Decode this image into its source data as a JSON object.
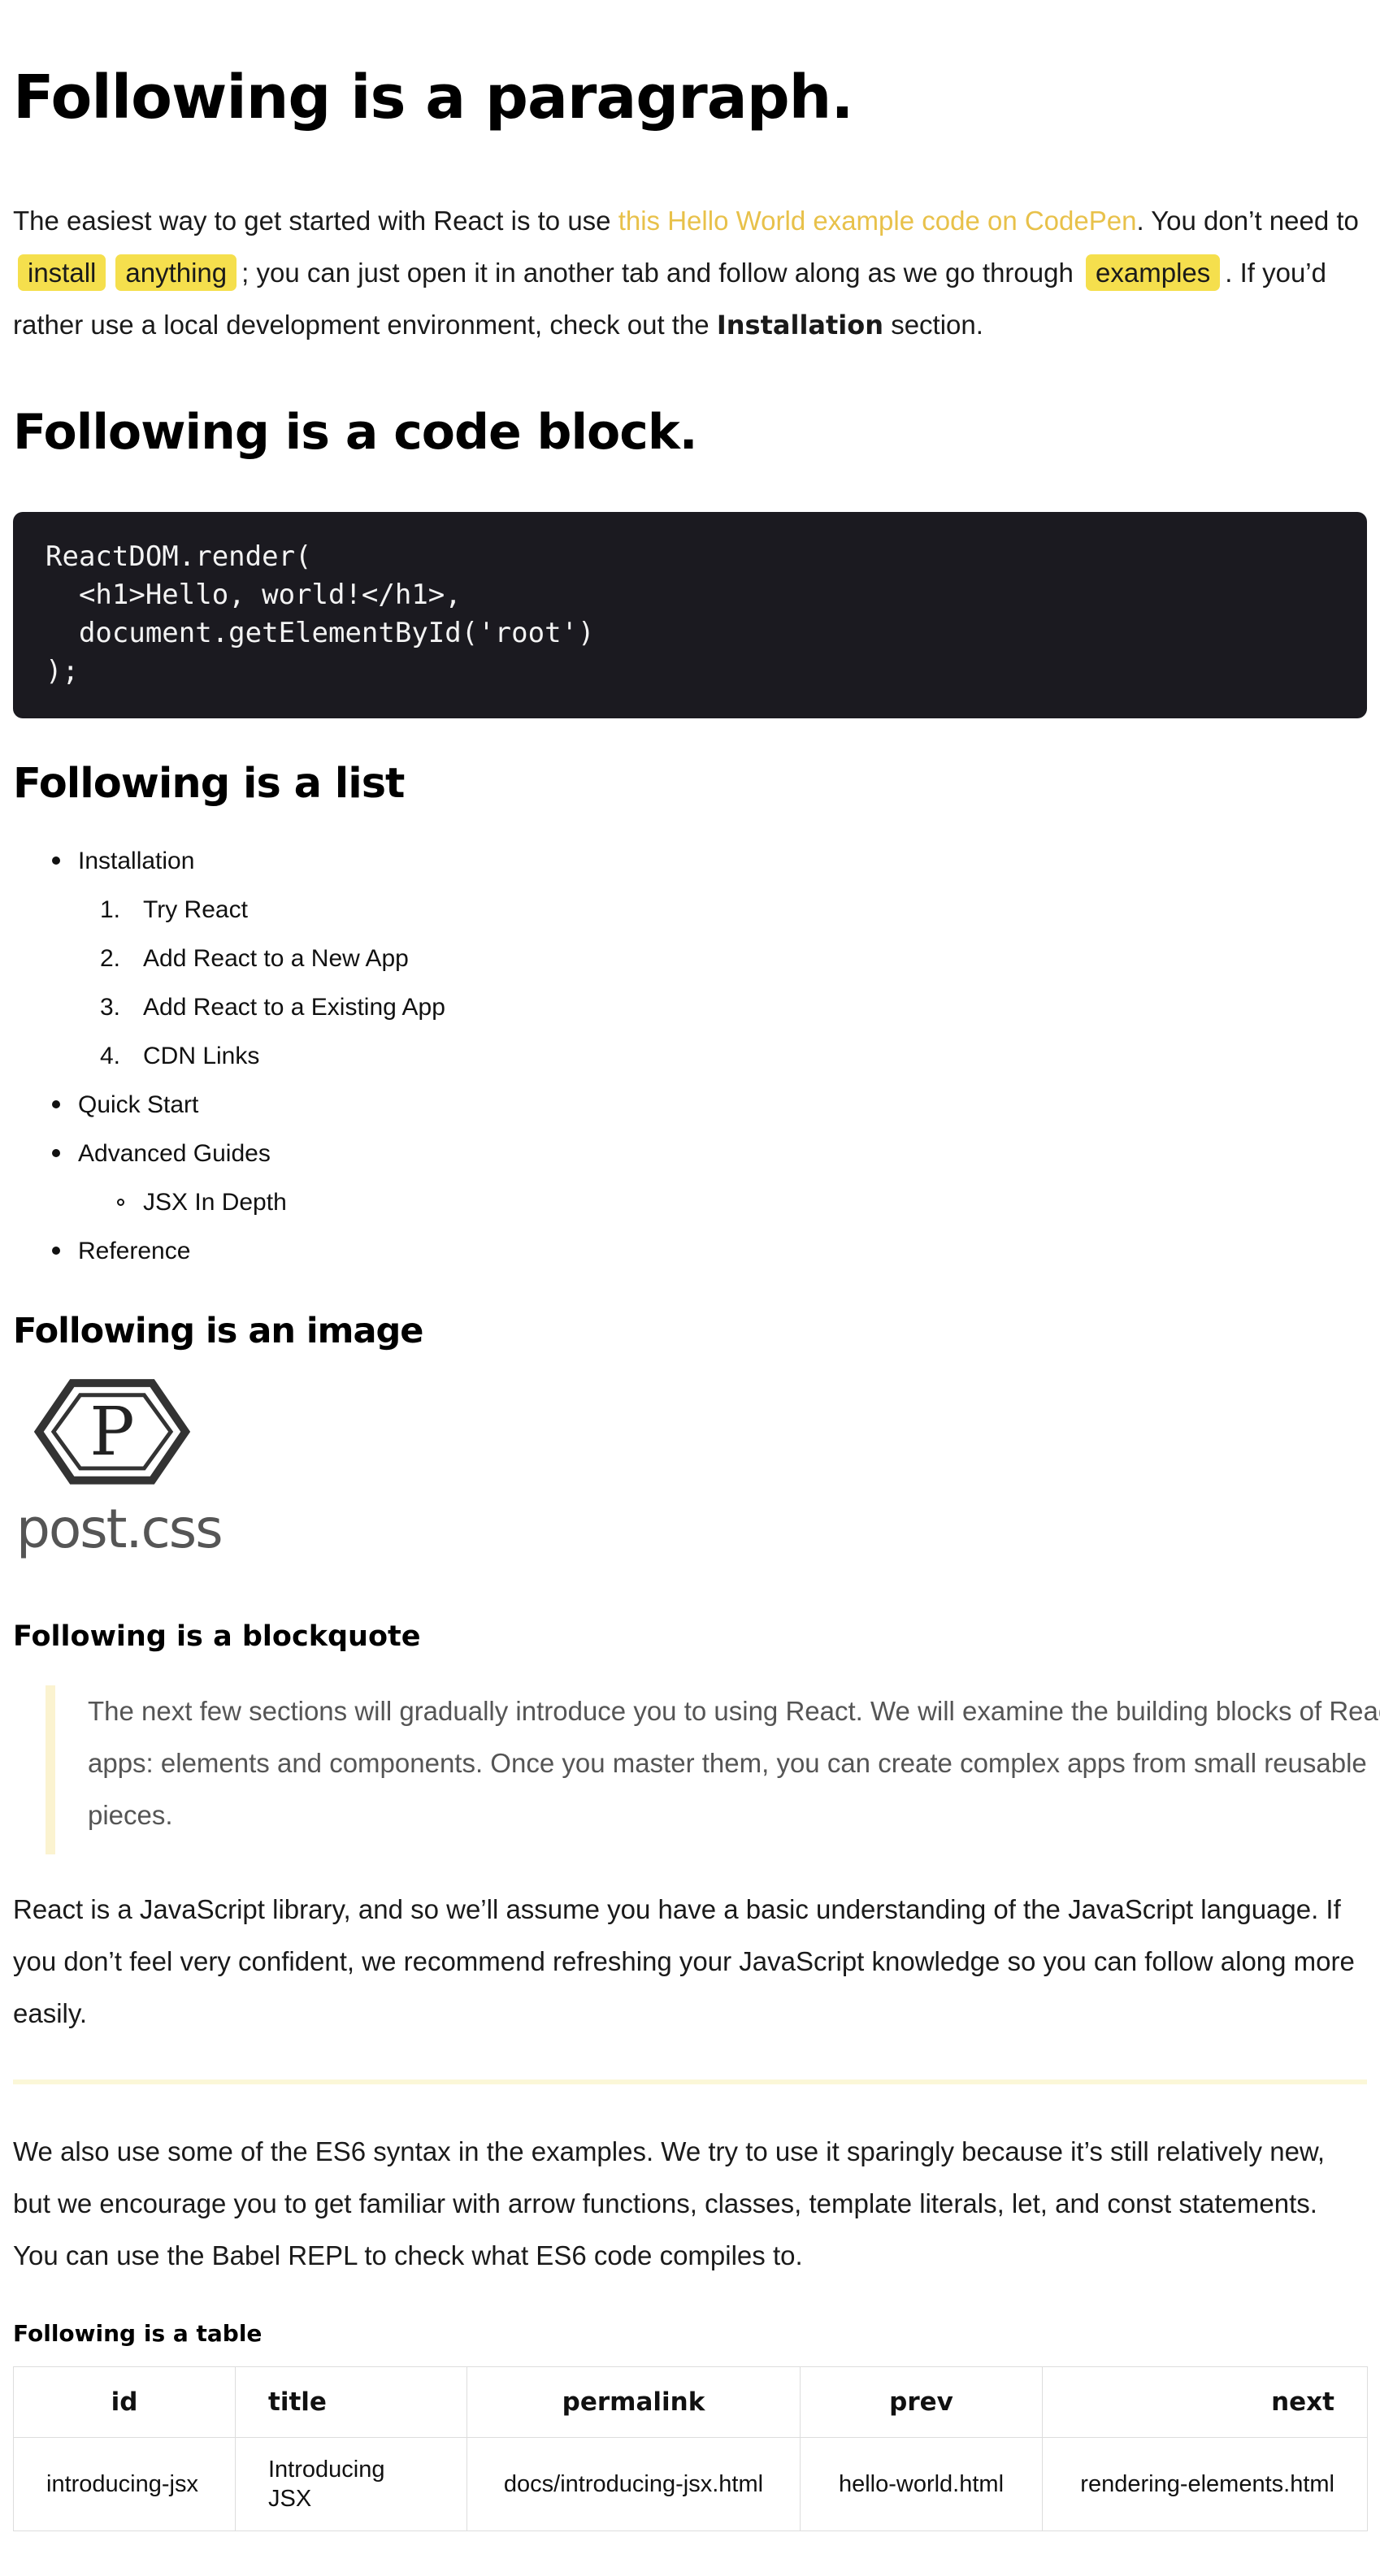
{
  "heading_paragraph": "Following is a paragraph.",
  "paragraph1": {
    "text_before_link": "The easiest way to get started with React is to use ",
    "link_text": "this Hello World example code on CodePen",
    "text_after_link": ". You don’t need to ",
    "mark1": "install",
    "mark2": "anything",
    "text_middle": "; you can just open it in another tab and follow along as we go through ",
    "mark3": "examples",
    "text_after_mark3": ". If you’d rather use a local development environment, check out the ",
    "strong": "Installation",
    "text_end": " section."
  },
  "heading_code": "Following is a code block.",
  "code_block": "ReactDOM.render(\n  <h1>Hello, world!</h1>,\n  document.getElementById('root')\n);",
  "heading_list": "Following is a list",
  "list": {
    "installation": "Installation",
    "installation_items": [
      "Try React",
      "Add React to a New App",
      "Add React to a Existing App",
      "CDN Links"
    ],
    "quick_start": "Quick Start",
    "advanced_guides": "Advanced Guides",
    "advanced_items": [
      "JSX In Depth"
    ],
    "reference": "Reference"
  },
  "ordered_numbers": [
    "1.",
    "2.",
    "3.",
    "4."
  ],
  "heading_image": "Following is an image",
  "image_logo_text": "post.css",
  "image_logo_letter": "P",
  "heading_blockquote": "Following is a blockquote",
  "blockquote": "The next few sections will gradually introduce you to using React. We will examine the building blocks of React apps: elements and components. Once you master them, you can create complex apps from small reusable pieces.",
  "paragraph2": "React is a JavaScript library, and so we’ll assume you have a basic understanding of the JavaScript language. If you don’t feel very confident, we recommend refreshing your JavaScript knowledge so you can follow along more easily.",
  "paragraph3": "We also use some of the ES6 syntax in the examples. We try to use it sparingly because it’s still relatively new, but we encourage you to get familiar with arrow functions, classes, template literals, let, and const statements. You can use the Babel REPL to check what ES6 code compiles to.",
  "heading_table": "Following is a table",
  "table": {
    "headers": [
      "id",
      "title",
      "permalink",
      "prev",
      "next"
    ],
    "rows": [
      [
        "introducing-jsx",
        "Introducing JSX",
        "docs/introducing-jsx.html",
        "hello-world.html",
        "rendering-elements.html"
      ]
    ]
  },
  "colors": {
    "link": "#e8c14a",
    "mark": "#f5df4d",
    "code_bg": "#1b1a20",
    "blockquote_border": "#fbf3d0",
    "hr": "#fbf7d8"
  }
}
